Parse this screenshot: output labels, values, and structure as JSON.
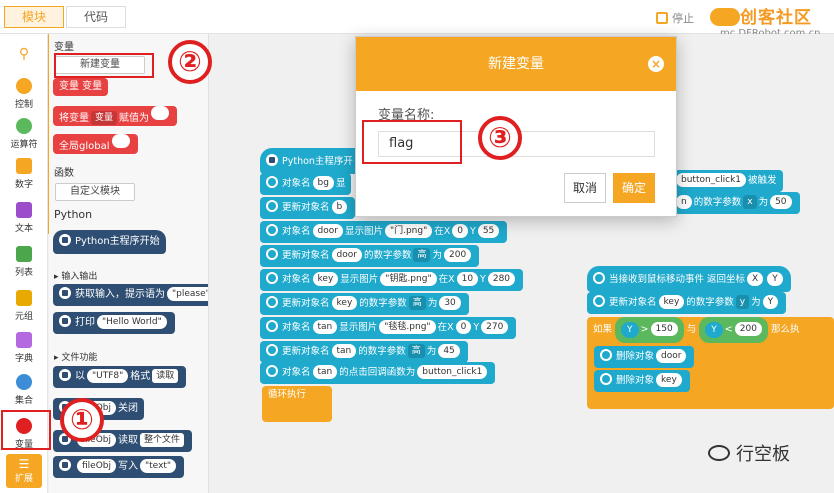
{
  "tabs": {
    "blocks": "模块",
    "code": "代码"
  },
  "stop_label": "停止",
  "brand": {
    "name": "创客社区",
    "url": "mc.DFRobot.com.cn"
  },
  "categories": [
    {
      "label": "控制",
      "color": "#f5a623"
    },
    {
      "label": "运算符",
      "color": "#5cb85c"
    },
    {
      "label": "数字",
      "color": "#f5a623"
    },
    {
      "label": "文本",
      "color": "#9b4dca"
    },
    {
      "label": "列表",
      "color": "#4ca64c"
    },
    {
      "label": "元组",
      "color": "#e8a900"
    },
    {
      "label": "字典",
      "color": "#b469e0"
    },
    {
      "label": "集合",
      "color": "#3c8dd6"
    },
    {
      "label": "变量",
      "color": "#e02020"
    },
    {
      "label": "扩展",
      "color": "#f5a623"
    }
  ],
  "palette": {
    "var_header": "变量",
    "new_var_btn": "新建变量",
    "var_block": "变量 变量",
    "assign": {
      "prefix": "将变量",
      "var": "变量",
      "suffix": "赋值为"
    },
    "global": "全局global",
    "func_header": "函数",
    "custom_module_btn": "自定义模块",
    "python_header": "Python",
    "py_start": "Python主程序开始",
    "io_header": "输入输出",
    "input": {
      "text": "获取输入，提示语为",
      "arg": "please"
    },
    "print": {
      "text": "打印",
      "arg": "Hello World"
    },
    "file_header": "文件功能",
    "open": {
      "pre": "以",
      "enc": "UTF8",
      "mid": "格式",
      "mode": "读取"
    },
    "close": {
      "obj": "fileObj",
      "text": "关闭"
    },
    "read": {
      "obj": "fileObj",
      "text": "读取",
      "mode": "整个文件"
    },
    "write": {
      "obj": "fileObj",
      "text": "写入",
      "arg": "text"
    }
  },
  "workspace": {
    "main_hat": "Python主程序开",
    "rows": [
      {
        "a": "对象名",
        "b": "bg",
        "c": "显"
      },
      {
        "a": "更新对象名",
        "b": "b"
      },
      {
        "a": "对象名",
        "b": "door",
        "c": "显示图片",
        "d": "门.png",
        "e": "在X",
        "f": "0",
        "g": "Y",
        "h": "55"
      },
      {
        "a": "更新对象名",
        "b": "door",
        "c": "的数字参数",
        "d": "高",
        "e": "为",
        "f": "200"
      },
      {
        "a": "对象名",
        "b": "key",
        "c": "显示图片",
        "d": "钥匙.png",
        "e": "在X",
        "f": "10",
        "g": "Y",
        "h": "280"
      },
      {
        "a": "更新对象名",
        "b": "key",
        "c": "的数字参数",
        "d": "高",
        "e": "为",
        "f": "30"
      },
      {
        "a": "对象名",
        "b": "tan",
        "c": "显示图片",
        "d": "毯毯.png",
        "e": "在X",
        "f": "0",
        "g": "Y",
        "h": "270"
      },
      {
        "a": "更新对象名",
        "b": "tan",
        "c": "的数字参数",
        "d": "高",
        "e": "为",
        "f": "45"
      },
      {
        "a": "对象名",
        "b": "tan",
        "c": "的点击回调函数为",
        "d": "button_click1"
      }
    ],
    "loop": "循环执行",
    "event1": {
      "arg": "button_click1",
      "text": "被触发"
    },
    "event1_row": {
      "a": "n",
      "b": "的数字参数",
      "c": "x",
      "d": "为",
      "e": "50"
    },
    "event2": {
      "text": "当接收到鼠标移动事件 返回坐标",
      "x": "X",
      "y": "Y"
    },
    "event2_row": {
      "a": "更新对象名",
      "b": "key",
      "c": "的数字参数",
      "d": "y",
      "e": "为",
      "f": "Y"
    },
    "if_block": {
      "if": "如果",
      "v1": "Y",
      "op1": ">",
      "n1": "150",
      "and": "与",
      "v2": "Y",
      "op2": "<",
      "n2": "200",
      "then": "那么执"
    },
    "del1": {
      "text": "删除对象",
      "obj": "door"
    },
    "del2": {
      "text": "删除对象",
      "obj": "key"
    }
  },
  "dialog": {
    "title": "新建变量",
    "label": "变量名称:",
    "value": "flag",
    "cancel": "取消",
    "ok": "确定"
  },
  "annotations": {
    "one": "①",
    "two": "②",
    "three": "③"
  },
  "watermark": "行空板"
}
